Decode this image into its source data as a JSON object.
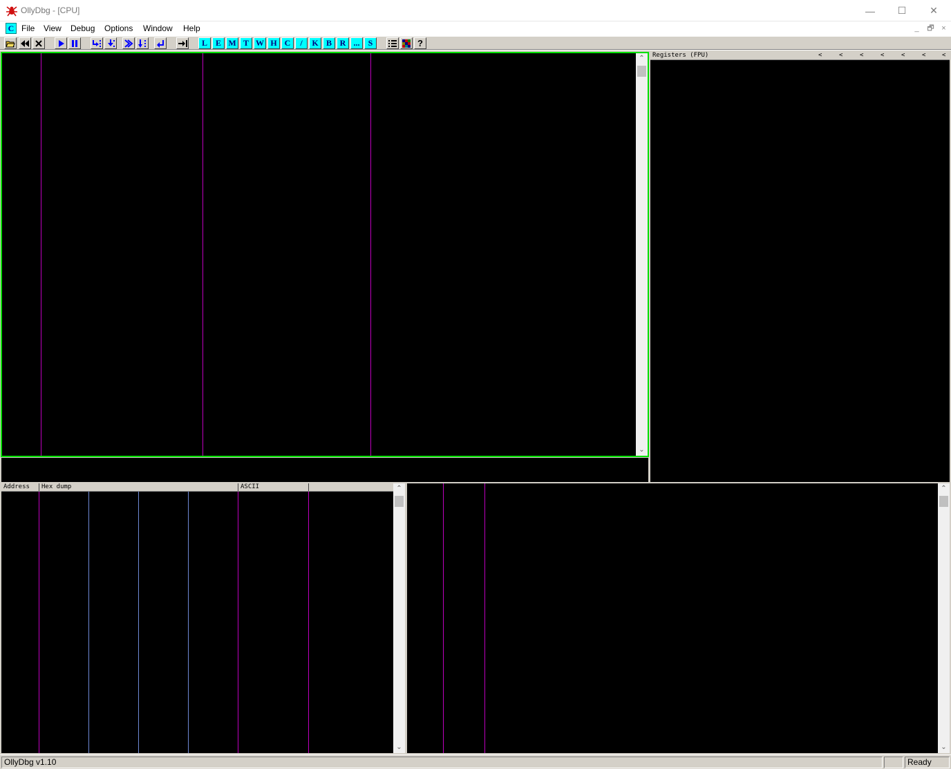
{
  "window": {
    "title": "OllyDbg - [CPU]",
    "controls": {
      "minimize": "—",
      "maximize": "☐",
      "close": "✕"
    }
  },
  "menubar": {
    "mdi_icon_letter": "C",
    "items": [
      "File",
      "View",
      "Debug",
      "Options",
      "Window",
      "Help"
    ],
    "mdi_controls": {
      "minimize": "_",
      "restore": "🗗",
      "close": "×"
    }
  },
  "toolbar": {
    "window_buttons": [
      "L",
      "E",
      "M",
      "T",
      "W",
      "H",
      "C",
      "/",
      "K",
      "B",
      "R",
      "...",
      "S"
    ]
  },
  "panes": {
    "registers_header": "Registers (FPU)",
    "registers_arrows": [
      "<",
      "<",
      "<",
      "<",
      "<",
      "<",
      "<"
    ],
    "dump_columns": [
      "Address",
      "Hex dump",
      "ASCII"
    ]
  },
  "statusbar": {
    "left": "OllyDbg v1.10",
    "right": "Ready"
  },
  "colors": {
    "pane_background": "#000000",
    "active_border": "#00e000",
    "column_separator": "#c000c0",
    "hex_separator": "#6f8ad6",
    "toolbar_button": "#00ffff",
    "chrome": "#d4d0c8"
  }
}
